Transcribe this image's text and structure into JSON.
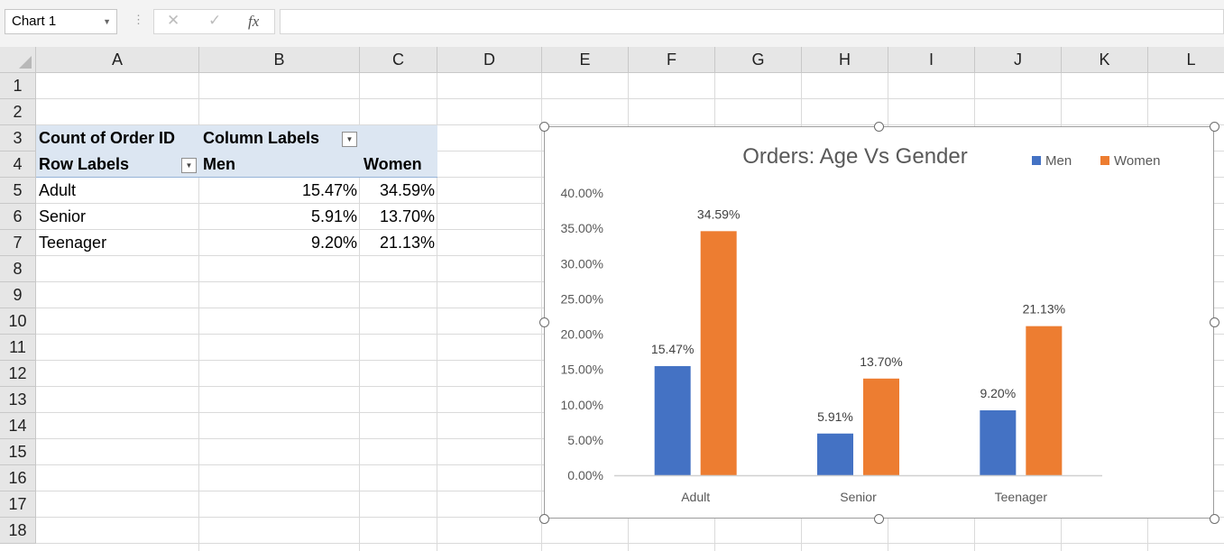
{
  "formula_bar": {
    "name_box": "Chart 1",
    "cancel_glyph": "✕",
    "enter_glyph": "✓",
    "fx_glyph": "fx",
    "formula": ""
  },
  "columns": [
    "A",
    "B",
    "C",
    "D",
    "E",
    "F",
    "G",
    "H",
    "I",
    "J",
    "K",
    "L"
  ],
  "rows": [
    "1",
    "2",
    "3",
    "4",
    "5",
    "6",
    "7",
    "8",
    "9",
    "10",
    "11",
    "12",
    "13",
    "14",
    "15",
    "16",
    "17",
    "18"
  ],
  "pivot": {
    "values_header": "Count of Order ID",
    "column_labels": "Column Labels",
    "row_labels": "Row Labels",
    "col_men": "Men",
    "col_women": "Women",
    "data": [
      {
        "label": "Adult",
        "men": "15.47%",
        "women": "34.59%"
      },
      {
        "label": "Senior",
        "men": "5.91%",
        "women": "13.70%"
      },
      {
        "label": "Teenager",
        "men": "9.20%",
        "women": "21.13%"
      }
    ]
  },
  "chart_data": {
    "type": "bar",
    "title": "Orders: Age Vs Gender",
    "categories": [
      "Adult",
      "Senior",
      "Teenager"
    ],
    "series": [
      {
        "name": "Men",
        "values": [
          15.47,
          5.91,
          9.2
        ],
        "color": "#4472c4",
        "labels": [
          "15.47%",
          "5.91%",
          "9.20%"
        ]
      },
      {
        "name": "Women",
        "values": [
          34.59,
          13.7,
          21.13
        ],
        "color": "#ed7d31",
        "labels": [
          "34.59%",
          "13.70%",
          "21.13%"
        ]
      }
    ],
    "ylim": [
      0,
      40
    ],
    "yticks": [
      "0.00%",
      "5.00%",
      "10.00%",
      "15.00%",
      "20.00%",
      "25.00%",
      "30.00%",
      "35.00%",
      "40.00%"
    ],
    "legend": "top-right",
    "grid": false
  }
}
